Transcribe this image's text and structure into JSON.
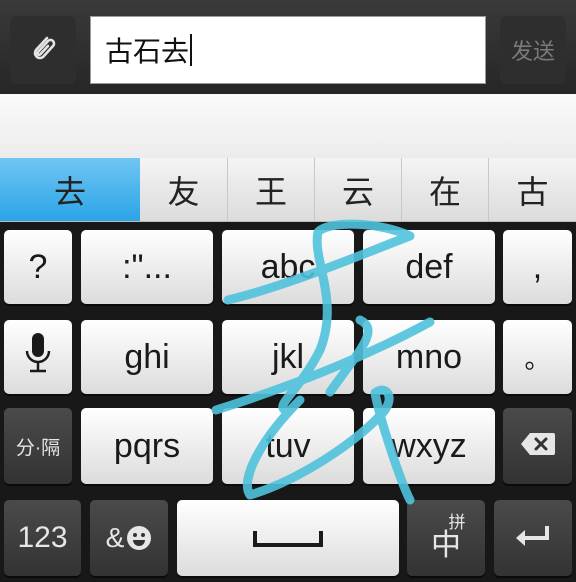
{
  "composer": {
    "attach_icon": "paperclip-icon",
    "input_text": "古石去",
    "send_label": "发送"
  },
  "candidates": [
    "去",
    "友",
    "王",
    "云",
    "在",
    "古"
  ],
  "keyboard": {
    "row1": {
      "left": "?",
      "k1": ":\"...",
      "k2": "abc",
      "k3": "def",
      "right": ","
    },
    "row2": {
      "left_icon": "microphone-icon",
      "k1": "ghi",
      "k2": "jkl",
      "k3": "mno",
      "right": "。"
    },
    "row3": {
      "left": "分·隔",
      "k1": "pqrs",
      "k2": "tuv",
      "k3": "wxyz",
      "right_icon": "backspace-icon"
    },
    "row4": {
      "numbers": "123",
      "symbols": "&",
      "symbols_icon": "smiley-icon",
      "space_icon": "space-icon",
      "lang_small": "拼",
      "lang_big": "中",
      "enter_icon": "enter-icon"
    }
  },
  "handwriting_trace_color": "#4fc2dc"
}
